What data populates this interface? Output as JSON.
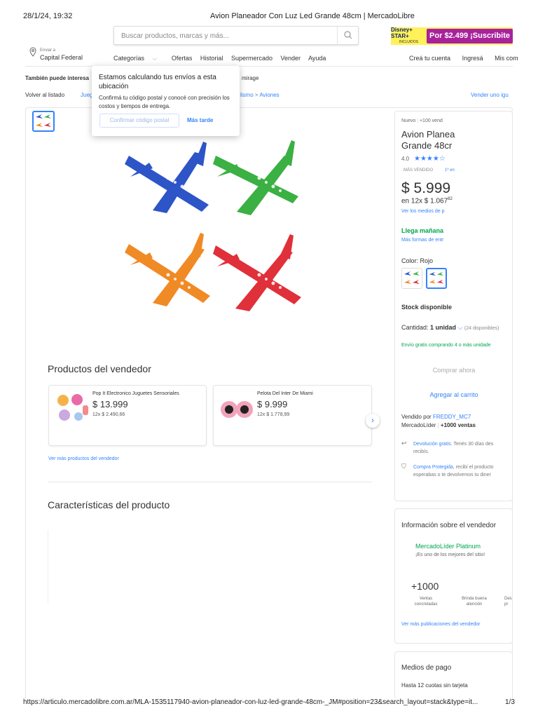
{
  "print": {
    "datetime": "28/1/24, 19:32",
    "title": "Avion Planeador Con Luz Led Grande 48cm | MercadoLibre",
    "url": "https://articulo.mercadolibre.com.ar/MLA-1535117940-avion-planeador-con-luz-led-grande-48cm-_JM#position=23&search_layout=stack&type=it...",
    "page": "1/3"
  },
  "search": {
    "placeholder": "Buscar productos, marcas y más..."
  },
  "promo": {
    "brand_line1": "Disney+",
    "brand_line2": "STAR+",
    "included": "INCLUIDOS",
    "offer": "Por $2.499 ¡Suscribite"
  },
  "location": {
    "label": "Enviar a",
    "value": "Capital Federal"
  },
  "nav": {
    "categories": "Categorías",
    "offers": "Ofertas",
    "history": "Historial",
    "supermarket": "Supermercado",
    "sell": "Vender",
    "help": "Ayuda",
    "create_account": "Creá tu cuenta",
    "login": "Ingresá",
    "purchases": "Mis com"
  },
  "related": {
    "label": "También puede interesa",
    "last": "mirage"
  },
  "breadcrumb": {
    "back": "Volver al listado",
    "first": "Jueg",
    "hobby": "lismo",
    "sep": ">",
    "current": "Aviones",
    "sell_same": "Vender uno igu"
  },
  "popup": {
    "title": "Estamos calculando tus envíos a esta ubicación",
    "body": "Confirmá tu código postal y conocé con precisión los costos y tiempos de entrega.",
    "confirm": "Confirmar código postal",
    "later": "Más tarde"
  },
  "product": {
    "condition": "Nuevo",
    "sold": "+100 vend",
    "title_line1": "Avion Planea",
    "title_line2": "Grande 48cr",
    "rating": "4.0",
    "stars": "★★★★☆",
    "bestseller": "MÁS VENDIDO",
    "rank": "1º en",
    "price": "$ 5.999",
    "installments": "en 12x $ 1.067",
    "installments_cents": "82",
    "payment_link": "Ver los medios de p",
    "delivery": "Llega mañana",
    "delivery_more": "Más formas de entr",
    "color_label": "Color:",
    "color_value": "Rojo",
    "stock": "Stock disponible",
    "qty_label": "Cantidad:",
    "qty_value": "1 unidad",
    "qty_avail": "(24 disponibles)",
    "free_ship": "Envío gratis comprando 4 o más unidade",
    "buy_now": "Comprar ahora",
    "add_cart": "Agregar al carrito",
    "sold_by": "Vendido por",
    "seller": "FREDDY_MC7",
    "leader": "MercadoLíder",
    "sales": "+1000 ventas",
    "returns_link": "Devolución gratis.",
    "returns_text": "Tenés 30 días des",
    "returns_text2": "recibís.",
    "protect_link": "Compra Protegida,",
    "protect_text": "recibí el producto",
    "protect_text2": "esperabas o te devolvemos tu diner"
  },
  "seller_products": {
    "heading": "Productos del vendedor",
    "items": [
      {
        "name": "Pop It Electronico Juguetes Sensoriales",
        "price": "$ 13.999",
        "inst": "12x $ 2.490,66"
      },
      {
        "name": "Pelota Del Inter De Miami",
        "price": "$ 9.999",
        "inst": "12x $ 1.778,99"
      }
    ],
    "more": "Ver más productos del vendedor",
    "next": "›"
  },
  "characteristics": {
    "heading": "Características del producto"
  },
  "seller_info": {
    "heading": "Información sobre el vendedor",
    "level": "MercadoLíder Platinum",
    "level_sub": "¡Es uno de los mejores del sitio!",
    "sales": "+1000",
    "sales_label1": "Ventas",
    "sales_label2": "concretadas",
    "service_label1": "Brinda buena",
    "service_label2": "atención",
    "delivery_label1": "Des",
    "delivery_label2": "pr",
    "more": "Ver más publicaciones del vendedor"
  },
  "payment": {
    "heading": "Medios de pago",
    "line": "Hasta 12 cuotas sin tarjeta"
  },
  "colors": {
    "blue": "#3483fa",
    "green": "#00a650",
    "yellow": "#fff159",
    "plane_blue": "#2d55c8",
    "plane_green": "#3bb043",
    "plane_orange": "#f08a25",
    "plane_red": "#e0303a"
  }
}
